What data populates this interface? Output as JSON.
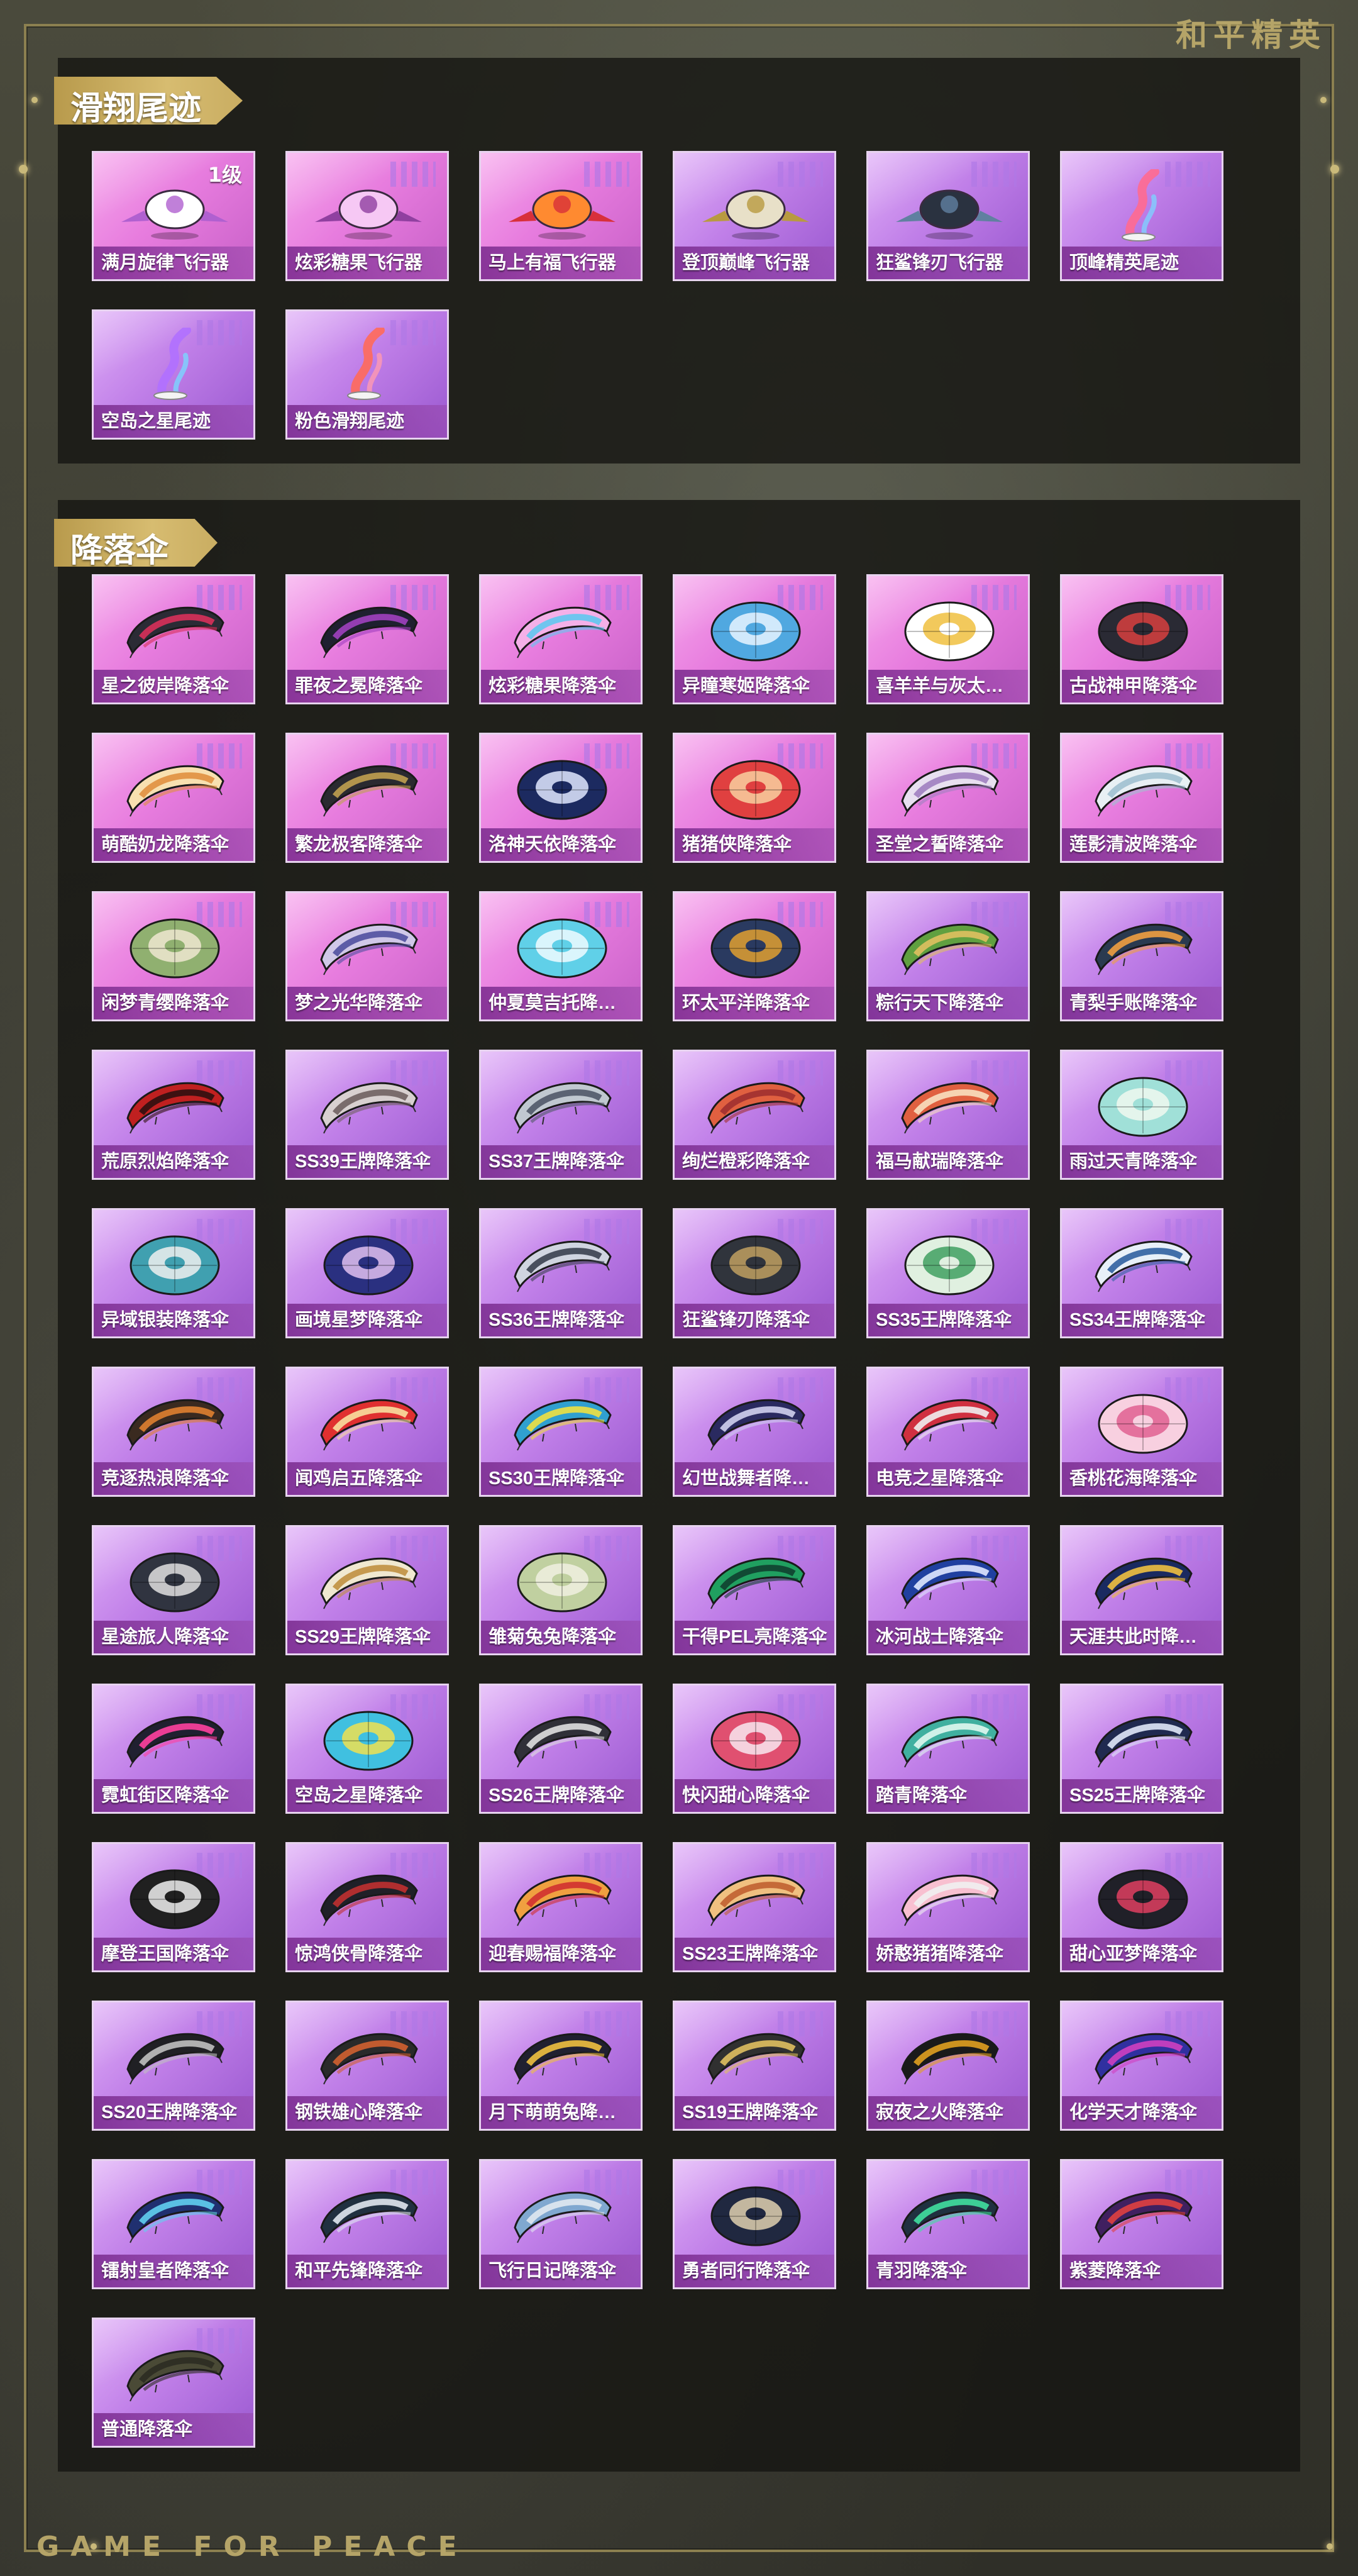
{
  "brand_logo": "和平精英",
  "footer_text": "GAME FOR PEACE",
  "sections": [
    {
      "title": "滑翔尾迹",
      "items": [
        {
          "name": "满月旋律飞行器",
          "icon": "carriage-glider-icon",
          "badge": "1级",
          "bg": "pink",
          "c1": "#ffffff",
          "c2": "#b060d0",
          "shape": "glider"
        },
        {
          "name": "炫彩糖果飞行器",
          "icon": "candy-glider-icon",
          "bg": "pink",
          "c1": "#f6c8f4",
          "c2": "#9040a0",
          "shape": "glider"
        },
        {
          "name": "马上有福飞行器",
          "icon": "horse-glider-icon",
          "bg": "pink",
          "c1": "#ff8a30",
          "c2": "#d8303a",
          "shape": "glider"
        },
        {
          "name": "登顶巅峰飞行器",
          "icon": "jet-glider-icon",
          "bg": "purple",
          "c1": "#e8e0c8",
          "c2": "#b89a40",
          "shape": "glider"
        },
        {
          "name": "狂鲨锋刃飞行器",
          "icon": "shark-glider-icon",
          "bg": "purple",
          "c1": "#2a3240",
          "c2": "#6080a0",
          "shape": "glider"
        },
        {
          "name": "顶峰精英尾迹",
          "icon": "elite-trail-icon",
          "bg": "purple",
          "c1": "#ff6a90",
          "c2": "#7fd0ff",
          "shape": "trail"
        },
        {
          "name": "空岛之星尾迹",
          "icon": "sky-island-trail-icon",
          "bg": "purple",
          "c1": "#b070ff",
          "c2": "#7ad6ff",
          "shape": "trail"
        },
        {
          "name": "粉色滑翔尾迹",
          "icon": "pink-trail-icon",
          "bg": "purple",
          "c1": "#ff6a5a",
          "c2": "#ff9ab0",
          "shape": "trail"
        }
      ]
    },
    {
      "title": "降落伞",
      "items": [
        {
          "name": "星之彼岸降落伞",
          "icon": "parachute-icon",
          "bg": "pink",
          "c1": "#2b2b35",
          "c2": "#d8305a",
          "shape": "chute"
        },
        {
          "name": "罪夜之冕降落伞",
          "icon": "parachute-icon",
          "bg": "pink",
          "c1": "#1f2030",
          "c2": "#a040c0",
          "shape": "chute"
        },
        {
          "name": "炫彩糖果降落伞",
          "icon": "parachute-icon",
          "bg": "pink",
          "c1": "#f4b0e8",
          "c2": "#60c8f0",
          "shape": "chute"
        },
        {
          "name": "异瞳寒姬降落伞",
          "icon": "parachute-icon",
          "bg": "pink",
          "c1": "#50a8e0",
          "c2": "#e8f4ff",
          "shape": "dome"
        },
        {
          "name": "喜羊羊与灰太…",
          "icon": "parachute-icon",
          "bg": "pink",
          "c1": "#ffffff",
          "c2": "#f0c040",
          "shape": "dome"
        },
        {
          "name": "古战神甲降落伞",
          "icon": "parachute-icon",
          "bg": "pink",
          "c1": "#2a2a34",
          "c2": "#d84040",
          "shape": "dome"
        },
        {
          "name": "萌酷奶龙降落伞",
          "icon": "parachute-icon",
          "bg": "pink",
          "c1": "#f8e0b0",
          "c2": "#e09040",
          "shape": "chute"
        },
        {
          "name": "繁龙极客降落伞",
          "icon": "parachute-icon",
          "bg": "pink",
          "c1": "#2a2a30",
          "c2": "#c0a050",
          "shape": "chute"
        },
        {
          "name": "洛神天依降落伞",
          "icon": "parachute-icon",
          "bg": "pink",
          "c1": "#1c2a60",
          "c2": "#e0e8ff",
          "shape": "dome"
        },
        {
          "name": "猪猪侠降落伞",
          "icon": "parachute-icon",
          "bg": "pink",
          "c1": "#e04040",
          "c2": "#f8d0a0",
          "shape": "dome"
        },
        {
          "name": "圣堂之誓降落伞",
          "icon": "parachute-icon",
          "bg": "pink",
          "c1": "#e8e0f0",
          "c2": "#a080c0",
          "shape": "chute"
        },
        {
          "name": "莲影清波降落伞",
          "icon": "parachute-icon",
          "bg": "pink",
          "c1": "#e8f0f4",
          "c2": "#a0c0d0",
          "shape": "chute"
        },
        {
          "name": "闲梦青缨降落伞",
          "icon": "parachute-icon",
          "bg": "pink",
          "c1": "#90b070",
          "c2": "#f0e8d0",
          "shape": "dome"
        },
        {
          "name": "梦之光华降落伞",
          "icon": "parachute-icon",
          "bg": "pink",
          "c1": "#d0c8e8",
          "c2": "#5050a0",
          "shape": "chute"
        },
        {
          "name": "仲夏莫吉托降…",
          "icon": "parachute-icon",
          "bg": "pink",
          "c1": "#60d0e8",
          "c2": "#f0fbff",
          "shape": "dome"
        },
        {
          "name": "环太平洋降落伞",
          "icon": "parachute-icon",
          "bg": "pink",
          "c1": "#2a3a60",
          "c2": "#e0a030",
          "shape": "dome"
        },
        {
          "name": "粽行天下降落伞",
          "icon": "parachute-icon",
          "bg": "purple",
          "c1": "#60a040",
          "c2": "#e0c060",
          "shape": "chute"
        },
        {
          "name": "青梨手账降落伞",
          "icon": "parachute-icon",
          "bg": "purple",
          "c1": "#2a3a50",
          "c2": "#f0a040",
          "shape": "chute"
        },
        {
          "name": "荒原烈焰降落伞",
          "icon": "parachute-icon",
          "bg": "purple",
          "c1": "#c02020",
          "c2": "#301010",
          "shape": "chute"
        },
        {
          "name": "SS39王牌降落伞",
          "icon": "parachute-icon",
          "bg": "purple",
          "c1": "#d8d0d0",
          "c2": "#706060",
          "shape": "chute"
        },
        {
          "name": "SS37王牌降落伞",
          "icon": "parachute-icon",
          "bg": "purple",
          "c1": "#c0c8d0",
          "c2": "#505868",
          "shape": "chute"
        },
        {
          "name": "绚烂橙彩降落伞",
          "icon": "parachute-icon",
          "bg": "purple",
          "c1": "#e06040",
          "c2": "#a03030",
          "shape": "chute"
        },
        {
          "name": "福马献瑞降落伞",
          "icon": "parachute-icon",
          "bg": "purple",
          "c1": "#e06040",
          "c2": "#f8e0c0",
          "shape": "chute"
        },
        {
          "name": "雨过天青降落伞",
          "icon": "parachute-icon",
          "bg": "purple",
          "c1": "#a0e0d8",
          "c2": "#f0f8f0",
          "shape": "dome"
        },
        {
          "name": "异域银装降落伞",
          "icon": "parachute-icon",
          "bg": "purple",
          "c1": "#40a0b0",
          "c2": "#f0f0f0",
          "shape": "dome"
        },
        {
          "name": "画境星梦降落伞",
          "icon": "parachute-icon",
          "bg": "purple",
          "c1": "#2a3080",
          "c2": "#e0c0f0",
          "shape": "dome"
        },
        {
          "name": "SS36王牌降落伞",
          "icon": "parachute-icon",
          "bg": "purple",
          "c1": "#d0d4e0",
          "c2": "#3a4050",
          "shape": "chute"
        },
        {
          "name": "狂鲨锋刃降落伞",
          "icon": "parachute-icon",
          "bg": "purple",
          "c1": "#30343c",
          "c2": "#c0a060",
          "shape": "dome"
        },
        {
          "name": "SS35王牌降落伞",
          "icon": "parachute-icon",
          "bg": "purple",
          "c1": "#e0f0e0",
          "c2": "#40a060",
          "shape": "dome"
        },
        {
          "name": "SS34王牌降落伞",
          "icon": "parachute-icon",
          "bg": "purple",
          "c1": "#e8f0f8",
          "c2": "#3060a0",
          "shape": "chute"
        },
        {
          "name": "竞逐热浪降落伞",
          "icon": "parachute-icon",
          "bg": "purple",
          "c1": "#3a2a20",
          "c2": "#e08030",
          "shape": "chute"
        },
        {
          "name": "闻鸡启五降落伞",
          "icon": "parachute-icon",
          "bg": "purple",
          "c1": "#e03030",
          "c2": "#f8e0a0",
          "shape": "chute"
        },
        {
          "name": "SS30王牌降落伞",
          "icon": "parachute-icon",
          "bg": "purple",
          "c1": "#30a0d0",
          "c2": "#f0e040",
          "shape": "chute"
        },
        {
          "name": "幻世战舞者降…",
          "icon": "parachute-icon",
          "bg": "purple",
          "c1": "#2a2a60",
          "c2": "#d0d0f0",
          "shape": "chute"
        },
        {
          "name": "电竞之星降落伞",
          "icon": "parachute-icon",
          "bg": "purple",
          "c1": "#d03040",
          "c2": "#f0f0f0",
          "shape": "chute"
        },
        {
          "name": "香桃花海降落伞",
          "icon": "parachute-icon",
          "bg": "purple",
          "c1": "#f8d0e0",
          "c2": "#e06090",
          "shape": "dome"
        },
        {
          "name": "星途旅人降落伞",
          "icon": "parachute-icon",
          "bg": "purple",
          "c1": "#303440",
          "c2": "#e0e0e0",
          "shape": "dome"
        },
        {
          "name": "SS29王牌降落伞",
          "icon": "parachute-icon",
          "bg": "purple",
          "c1": "#f0e8d0",
          "c2": "#c09040",
          "shape": "chute"
        },
        {
          "name": "雏菊兔兔降落伞",
          "icon": "parachute-icon",
          "bg": "purple",
          "c1": "#c0d0a0",
          "c2": "#f0f0e0",
          "shape": "dome"
        },
        {
          "name": "干得PEL亮降落伞",
          "icon": "parachute-icon",
          "bg": "purple",
          "c1": "#20a060",
          "c2": "#104030",
          "shape": "chute"
        },
        {
          "name": "冰河战士降落伞",
          "icon": "parachute-icon",
          "bg": "purple",
          "c1": "#2040a0",
          "c2": "#e0e8ff",
          "shape": "chute"
        },
        {
          "name": "天涯共此时降…",
          "icon": "parachute-icon",
          "bg": "purple",
          "c1": "#1a2a60",
          "c2": "#f0c040",
          "shape": "chute"
        },
        {
          "name": "霓虹街区降落伞",
          "icon": "parachute-icon",
          "bg": "purple",
          "c1": "#202030",
          "c2": "#ff40a0",
          "shape": "chute"
        },
        {
          "name": "空岛之星降落伞",
          "icon": "parachute-icon",
          "bg": "purple",
          "c1": "#40c0e0",
          "c2": "#f0e050",
          "shape": "dome"
        },
        {
          "name": "SS26王牌降落伞",
          "icon": "parachute-icon",
          "bg": "purple",
          "c1": "#303038",
          "c2": "#e0e0e0",
          "shape": "chute"
        },
        {
          "name": "快闪甜心降落伞",
          "icon": "parachute-icon",
          "bg": "purple",
          "c1": "#e05070",
          "c2": "#f8e8f0",
          "shape": "dome"
        },
        {
          "name": "踏青降落伞",
          "icon": "parachute-icon",
          "bg": "purple",
          "c1": "#40b0a0",
          "c2": "#e0f8f0",
          "shape": "chute"
        },
        {
          "name": "SS25王牌降落伞",
          "icon": "parachute-icon",
          "bg": "purple",
          "c1": "#202a50",
          "c2": "#e0e8f8",
          "shape": "chute"
        },
        {
          "name": "摩登王国降落伞",
          "icon": "parachute-icon",
          "bg": "purple",
          "c1": "#202020",
          "c2": "#f0f0f0",
          "shape": "dome"
        },
        {
          "name": "惊鸿侠骨降落伞",
          "icon": "parachute-icon",
          "bg": "purple",
          "c1": "#202028",
          "c2": "#c03030",
          "shape": "chute"
        },
        {
          "name": "迎春赐福降落伞",
          "icon": "parachute-icon",
          "bg": "purple",
          "c1": "#f0a040",
          "c2": "#d03030",
          "shape": "chute"
        },
        {
          "name": "SS23王牌降落伞",
          "icon": "parachute-icon",
          "bg": "purple",
          "c1": "#f0c080",
          "c2": "#c06030",
          "shape": "chute"
        },
        {
          "name": "娇憨猪猪降落伞",
          "icon": "parachute-icon",
          "bg": "purple",
          "c1": "#f8c0d0",
          "c2": "#f0f0f0",
          "shape": "chute"
        },
        {
          "name": "甜心亚梦降落伞",
          "icon": "parachute-icon",
          "bg": "purple",
          "c1": "#202028",
          "c2": "#e04060",
          "shape": "dome"
        },
        {
          "name": "SS20王牌降落伞",
          "icon": "parachute-icon",
          "bg": "purple",
          "c1": "#202024",
          "c2": "#c0c0c0",
          "shape": "chute"
        },
        {
          "name": "钢铁雄心降落伞",
          "icon": "parachute-icon",
          "bg": "purple",
          "c1": "#2a2a2a",
          "c2": "#d06030",
          "shape": "chute"
        },
        {
          "name": "月下萌萌兔降…",
          "icon": "parachute-icon",
          "bg": "purple",
          "c1": "#202030",
          "c2": "#f0c040",
          "shape": "chute"
        },
        {
          "name": "SS19王牌降落伞",
          "icon": "parachute-icon",
          "bg": "purple",
          "c1": "#303030",
          "c2": "#e0c060",
          "shape": "chute"
        },
        {
          "name": "寂夜之火降落伞",
          "icon": "parachute-icon",
          "bg": "purple",
          "c1": "#1a1a1a",
          "c2": "#e0a020",
          "shape": "chute"
        },
        {
          "name": "化学天才降落伞",
          "icon": "parachute-icon",
          "bg": "purple",
          "c1": "#3030a0",
          "c2": "#d040c0",
          "shape": "chute"
        },
        {
          "name": "镭射皇者降落伞",
          "icon": "parachute-icon",
          "bg": "purple",
          "c1": "#203070",
          "c2": "#60d0f0",
          "shape": "chute"
        },
        {
          "name": "和平先锋降落伞",
          "icon": "parachute-icon",
          "bg": "purple",
          "c1": "#203040",
          "c2": "#e0e8f0",
          "shape": "chute"
        },
        {
          "name": "飞行日记降落伞",
          "icon": "parachute-icon",
          "bg": "purple",
          "c1": "#80a8d0",
          "c2": "#e0e8f0",
          "shape": "chute"
        },
        {
          "name": "勇者同行降落伞",
          "icon": "parachute-icon",
          "bg": "purple",
          "c1": "#202840",
          "c2": "#e0d0b0",
          "shape": "dome"
        },
        {
          "name": "青羽降落伞",
          "icon": "parachute-icon",
          "bg": "purple",
          "c1": "#203040",
          "c2": "#40e0a0",
          "shape": "chute"
        },
        {
          "name": "紫菱降落伞",
          "icon": "parachute-icon",
          "bg": "purple",
          "c1": "#402060",
          "c2": "#e04040",
          "shape": "chute"
        },
        {
          "name": "普通降落伞",
          "icon": "parachute-icon",
          "bg": "purple",
          "c1": "#4a4a36",
          "c2": "#2c2c22",
          "shape": "chute"
        }
      ]
    }
  ]
}
